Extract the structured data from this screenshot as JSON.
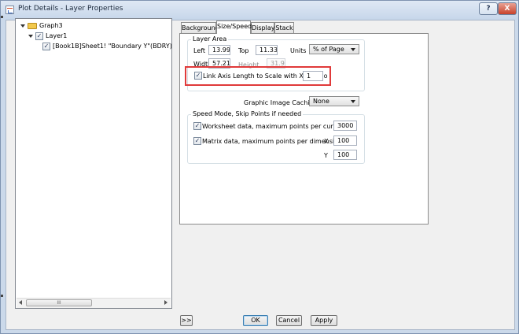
{
  "window": {
    "title": "Plot Details - Layer Properties",
    "help_label": "?",
    "close_label": "X"
  },
  "tree": {
    "items": [
      {
        "label": "Graph3",
        "checkbox": false,
        "expanded": true
      },
      {
        "label": "Layer1",
        "checkbox": true,
        "expanded": true
      },
      {
        "label": "[Book1B]Sheet1! \"Boundary Y\"(BDRY), \"Bound",
        "checkbox": true
      }
    ],
    "scroll_thumb_label": "III"
  },
  "tabs": [
    {
      "label": "Background",
      "active": false
    },
    {
      "label": "Size/Speed",
      "active": true
    },
    {
      "label": "Display",
      "active": false
    },
    {
      "label": "Stack",
      "active": false
    }
  ],
  "layer_area": {
    "title": "Layer Area",
    "left_label": "Left",
    "left_value": "13.99",
    "top_label": "Top",
    "top_value": "11.33",
    "units_label": "Units",
    "units_value": "% of Page",
    "width_label": "Width",
    "width_value": "57.21",
    "height_label": "Height",
    "height_value": "31.97",
    "link_label": "Link Axis Length to Scale with X:Y Ratio",
    "link_checked": true,
    "link_value": "1"
  },
  "caching": {
    "label": "Graphic Image Caching",
    "value": "None"
  },
  "speed_mode": {
    "title": "Speed Mode, Skip Points if needed",
    "worksheet_label": "Worksheet data, maximum points per curve",
    "worksheet_checked": true,
    "worksheet_value": "3000",
    "matrix_label": "Matrix data, maximum points per dimension",
    "matrix_checked": true,
    "x_label": "X",
    "x_value": "100",
    "y_label": "Y",
    "y_value": "100"
  },
  "buttons": {
    "expand": ">>",
    "ok": "OK",
    "cancel": "Cancel",
    "apply": "Apply"
  },
  "colors": {
    "highlight": "#e03a3a",
    "titlebar": "#c6d6ea",
    "close": "#c8412a"
  }
}
